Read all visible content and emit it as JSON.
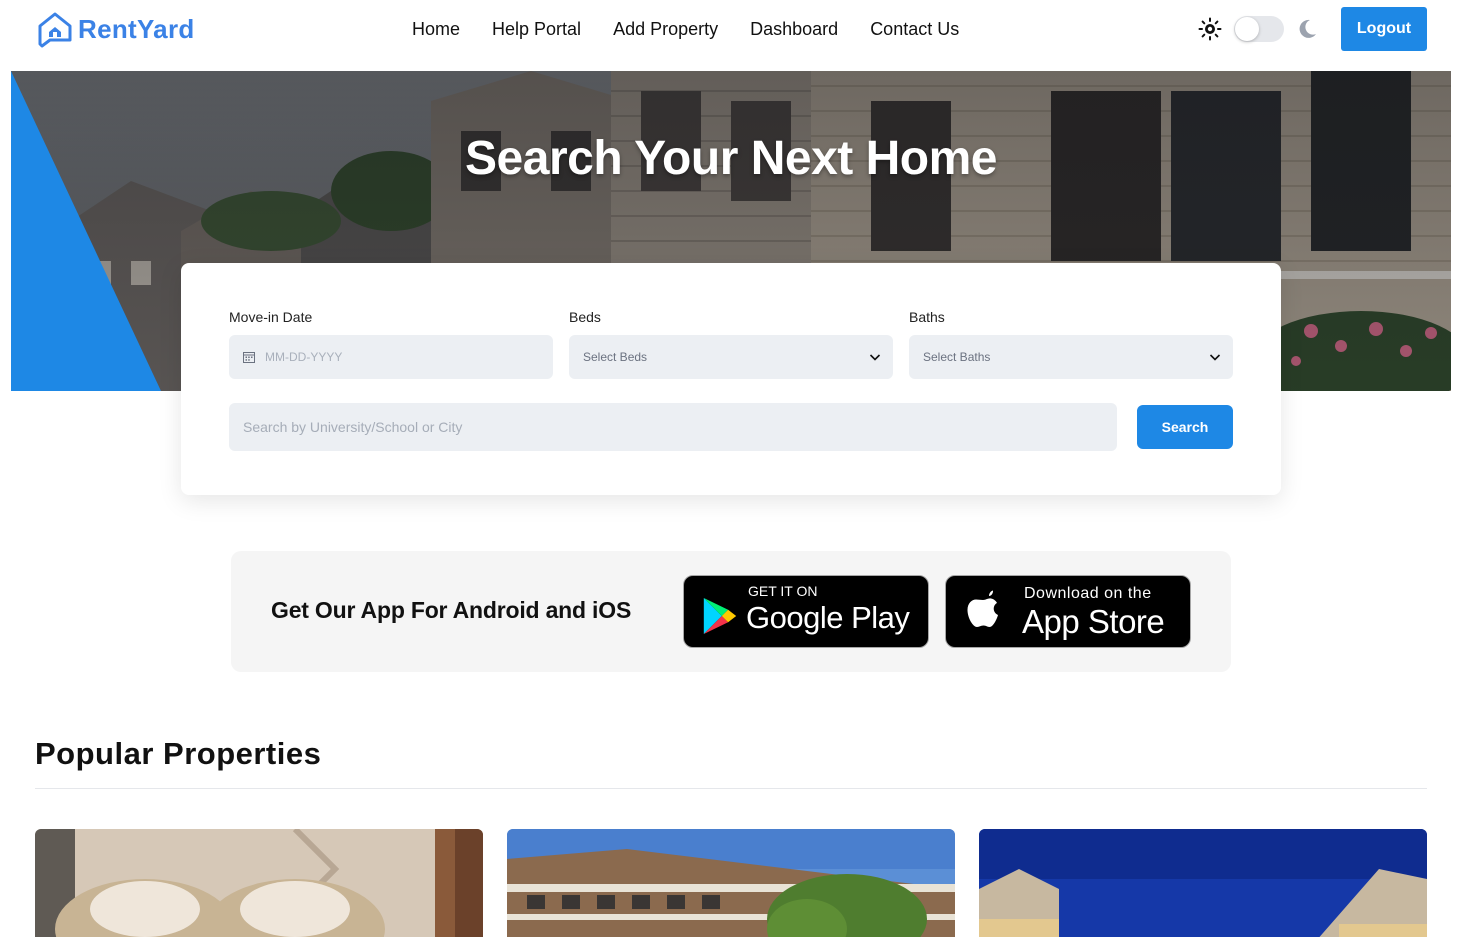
{
  "header": {
    "logo_text": "RentYard",
    "logo_icon": "house-chat-icon",
    "nav": [
      {
        "label": "Home"
      },
      {
        "label": "Help Portal"
      },
      {
        "label": "Add Property"
      },
      {
        "label": "Dashboard"
      },
      {
        "label": "Contact Us"
      }
    ],
    "theme_toggle": {
      "light_icon": "sun-icon",
      "dark_icon": "moon-icon",
      "mode": "light"
    },
    "logout_label": "Logout"
  },
  "hero": {
    "title": "Search Your Next Home"
  },
  "search": {
    "move_in_label": "Move-in Date",
    "move_in_placeholder": "MM-DD-YYYY",
    "beds_label": "Beds",
    "beds_value": "Select Beds",
    "baths_label": "Baths",
    "baths_value": "Select Baths",
    "query_placeholder": "Search by University/School or City",
    "button_label": "Search"
  },
  "app_banner": {
    "text": "Get Our App For Android and iOS",
    "google_play": {
      "small": "GET IT ON",
      "big": "Google Play"
    },
    "app_store": {
      "small": "Download on the",
      "big": "App Store"
    }
  },
  "popular": {
    "title": "Popular Properties"
  },
  "colors": {
    "accent": "#1e88e5",
    "logo": "#3b82e6",
    "field_bg": "#eceff3",
    "banner_bg": "#f5f5f5"
  }
}
